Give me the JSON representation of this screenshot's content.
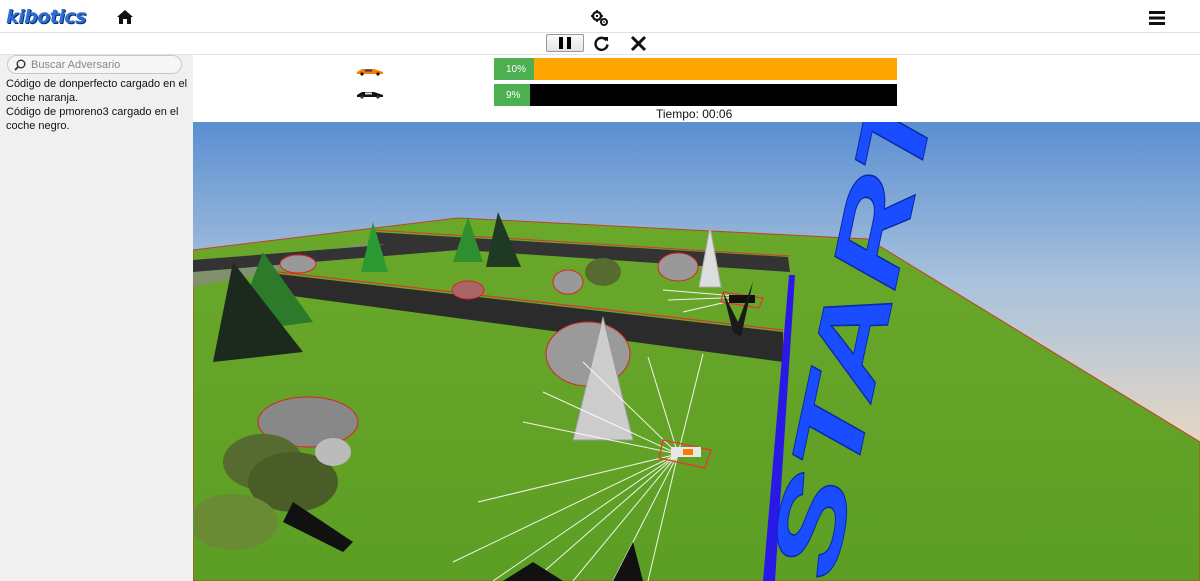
{
  "app": {
    "logo_text": "kibotics",
    "home_icon": "home-icon",
    "settings_icon": "gears-icon",
    "menu_icon": "hamburger-menu-icon"
  },
  "controls": {
    "pause_icon": "pause-icon",
    "reload_icon": "reload-icon",
    "close_icon": "close-icon"
  },
  "sidebar": {
    "search_placeholder": "Buscar Adversario",
    "log": [
      "Código de donperfecto cargado en el coche naranja.",
      "Código de pmoreno3 cargado en el coche negro."
    ]
  },
  "race": {
    "cars": [
      {
        "label": "10%",
        "progress": 0.1,
        "bar_color": "#ffa500",
        "car_color": "#ff7a00"
      },
      {
        "label": "9%",
        "progress": 0.09,
        "bar_color": "#000000",
        "car_color": "#111111"
      }
    ],
    "done_color": "#4caf50",
    "timer": "Tiempo: 00:06"
  },
  "scene": {
    "start_text": "START",
    "start_color": "#1a4dff",
    "grass_color": "#5fa62a",
    "sky_color": "#6a9fd8",
    "sand_color": "#ead7bd"
  }
}
